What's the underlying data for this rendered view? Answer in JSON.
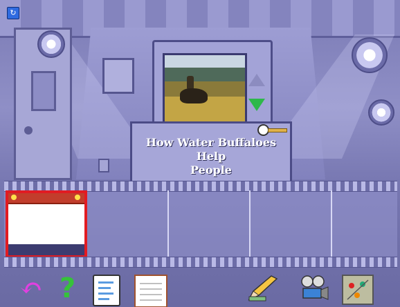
{
  "scene": {
    "caption_line1": "How Water Buffaloes Help",
    "caption_line2": "People"
  },
  "icons": {
    "corner": "app-menu-icon",
    "back": "back-arrow-icon",
    "help": "help-question-icon",
    "notes": "notepad-icon",
    "clipboard": "clipboard-icon",
    "pencil": "pencil-icon",
    "projector": "projector-icon",
    "map": "map-icon"
  },
  "colors": {
    "selection": "#e11b22",
    "down_arrow": "#2db84a",
    "help": "#36c23a",
    "back": "#e040e0"
  }
}
